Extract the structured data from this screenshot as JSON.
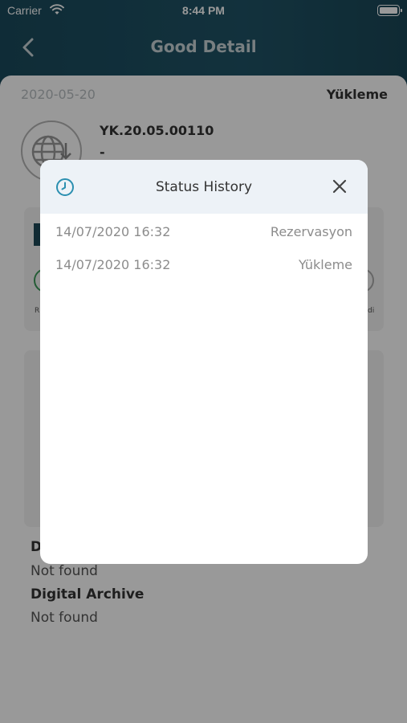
{
  "status_bar": {
    "carrier": "Carrier",
    "time": "8:44 PM"
  },
  "nav": {
    "title": "Good Detail",
    "back_icon": "chevron-left-icon"
  },
  "background": {
    "date": "2020-05-20",
    "status": "Yükleme",
    "code": "YK.20.05.00110",
    "dash": "-",
    "step_left_letter": "R",
    "step_right_letter": "di",
    "section_a_letter": "D",
    "section_a_value": "Not found",
    "section_b_title": "Digital Archive",
    "section_b_value": "Not found"
  },
  "modal": {
    "title": "Status History",
    "icon": "clock-icon",
    "close_icon": "close-icon",
    "accent": "#2b8fb0",
    "entries": [
      {
        "timestamp": "14/07/2020 16:32",
        "status": "Rezervasyon"
      },
      {
        "timestamp": "14/07/2020 16:32",
        "status": "Yükleme"
      }
    ]
  }
}
